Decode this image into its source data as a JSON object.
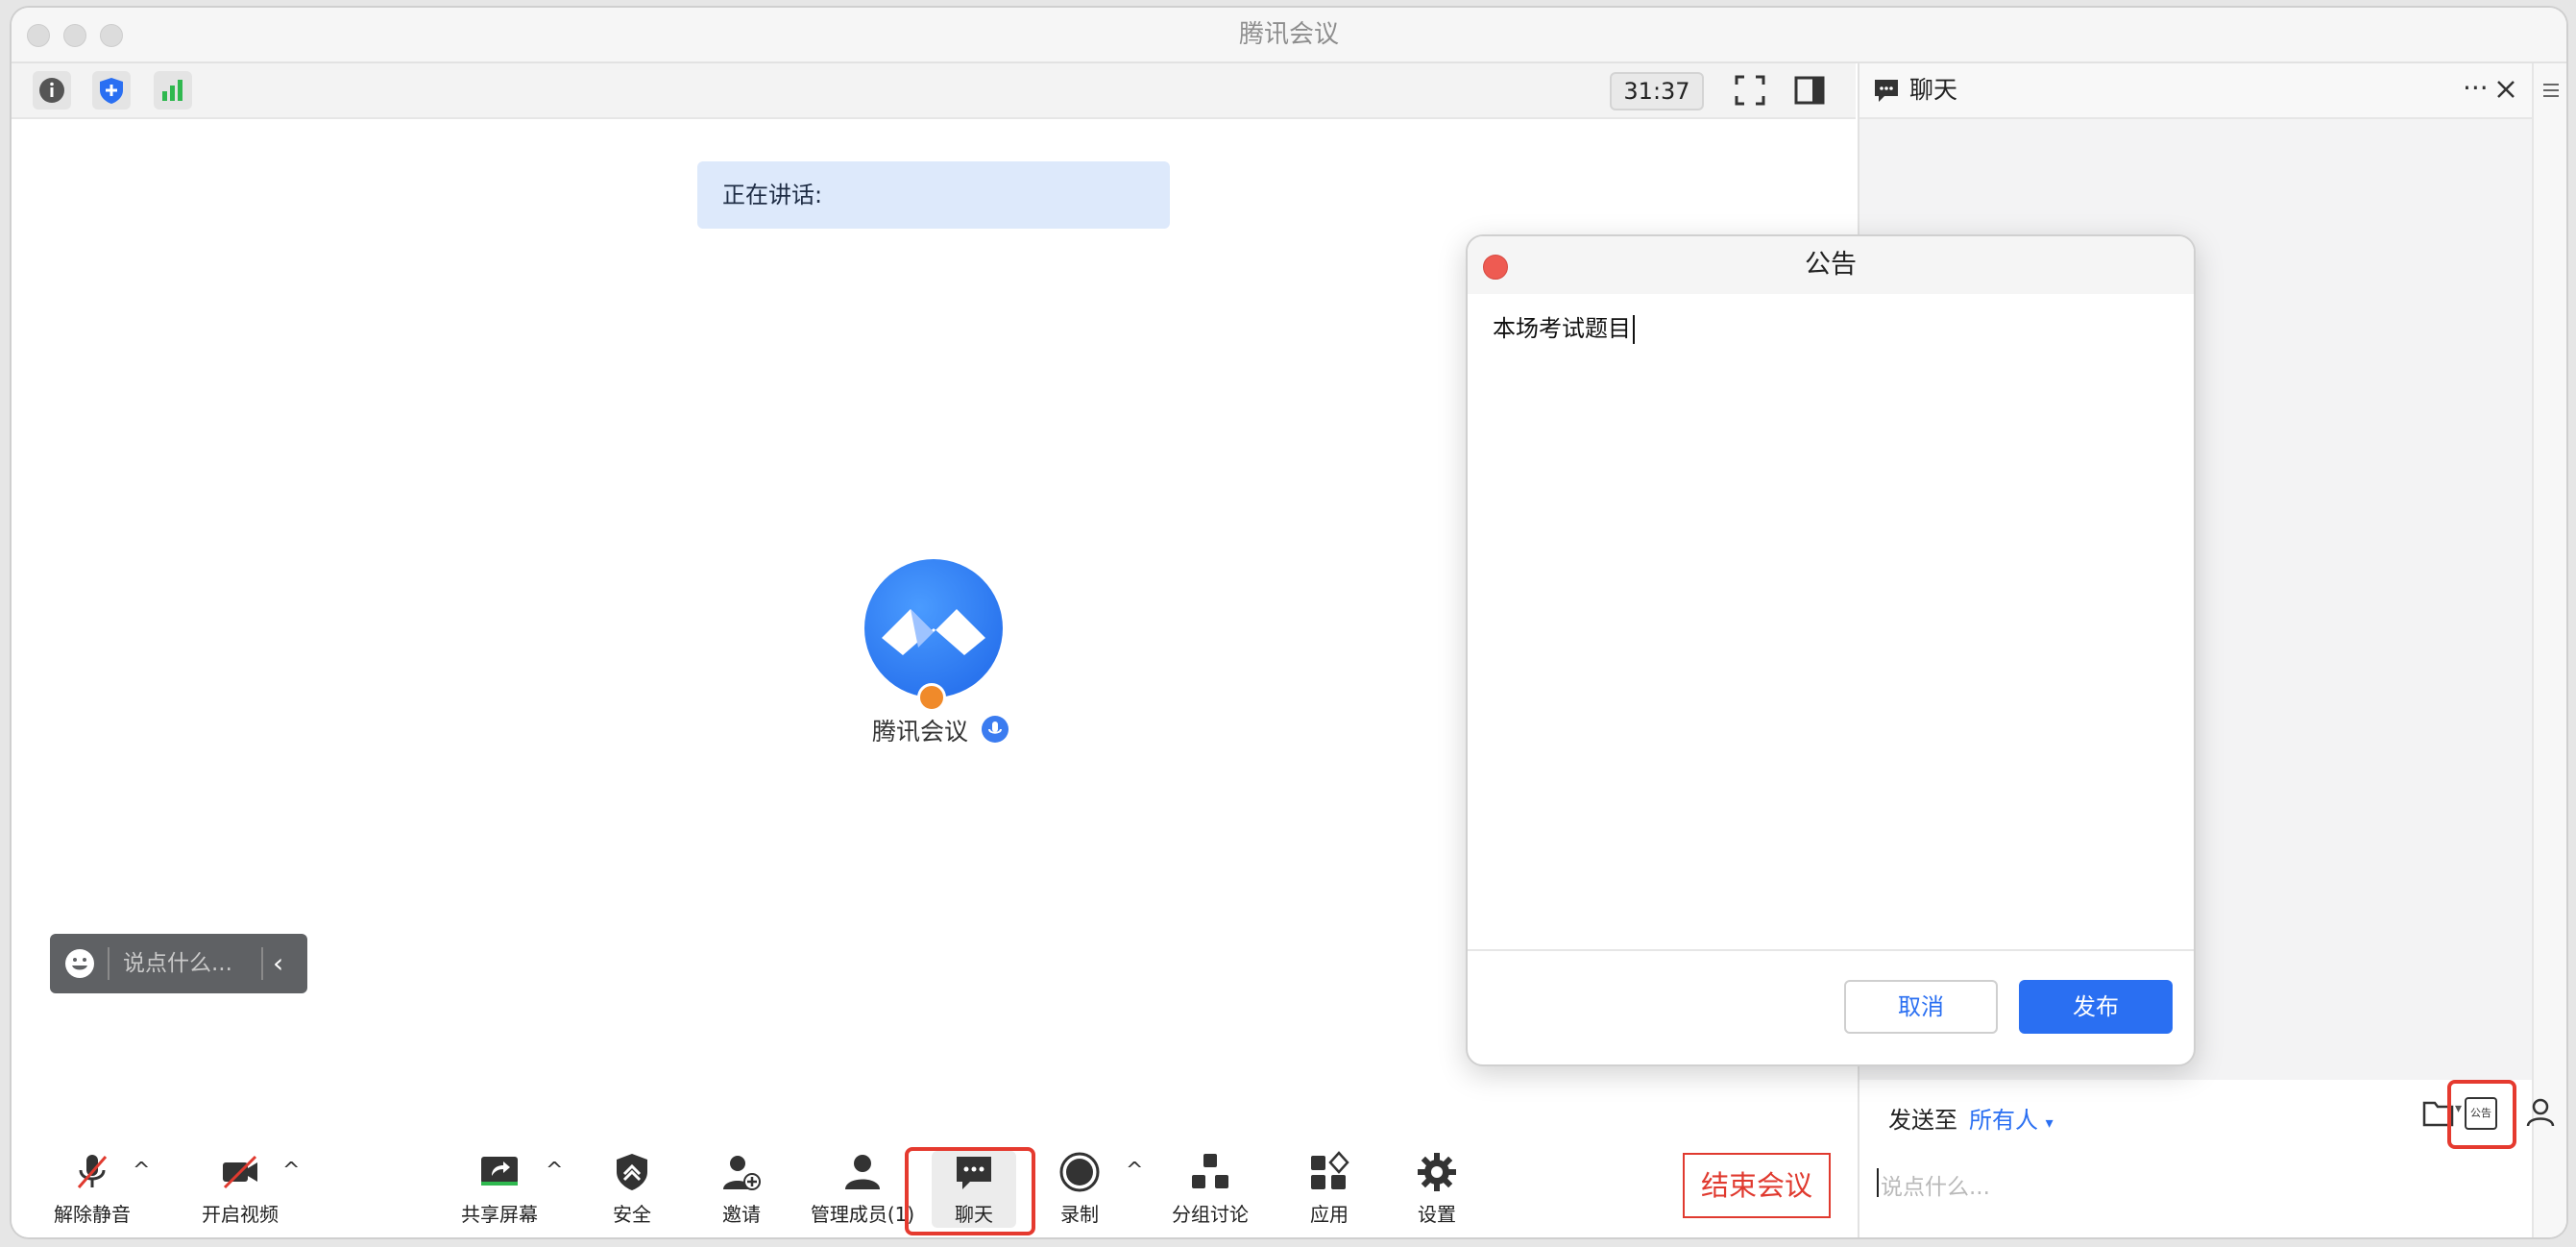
{
  "window": {
    "title": "腾讯会议"
  },
  "infobar": {
    "timer": "31:37"
  },
  "stage": {
    "speaking_label": "正在讲话:",
    "participant_name": "腾讯会议",
    "chat_bubble_placeholder": "说点什么..."
  },
  "toolbar": {
    "unmute": "解除静音",
    "start_video": "开启视频",
    "share_screen": "共享屏幕",
    "security": "安全",
    "invite": "邀请",
    "manage_members": "管理成员(1)",
    "chat": "聊天",
    "record": "录制",
    "breakout": "分组讨论",
    "apps": "应用",
    "settings": "设置",
    "end_meeting": "结束会议"
  },
  "chat_panel": {
    "title": "聊天",
    "send_to_label": "发送至",
    "send_to_value": "所有人",
    "announce_icon_text": "公告",
    "input_placeholder": "说点什么..."
  },
  "modal": {
    "title": "公告",
    "content": "本场考试题目",
    "cancel": "取消",
    "publish": "发布"
  },
  "colors": {
    "accent": "#2a6ff2",
    "danger": "#e03a2f",
    "highlight": "#e53a2f"
  }
}
